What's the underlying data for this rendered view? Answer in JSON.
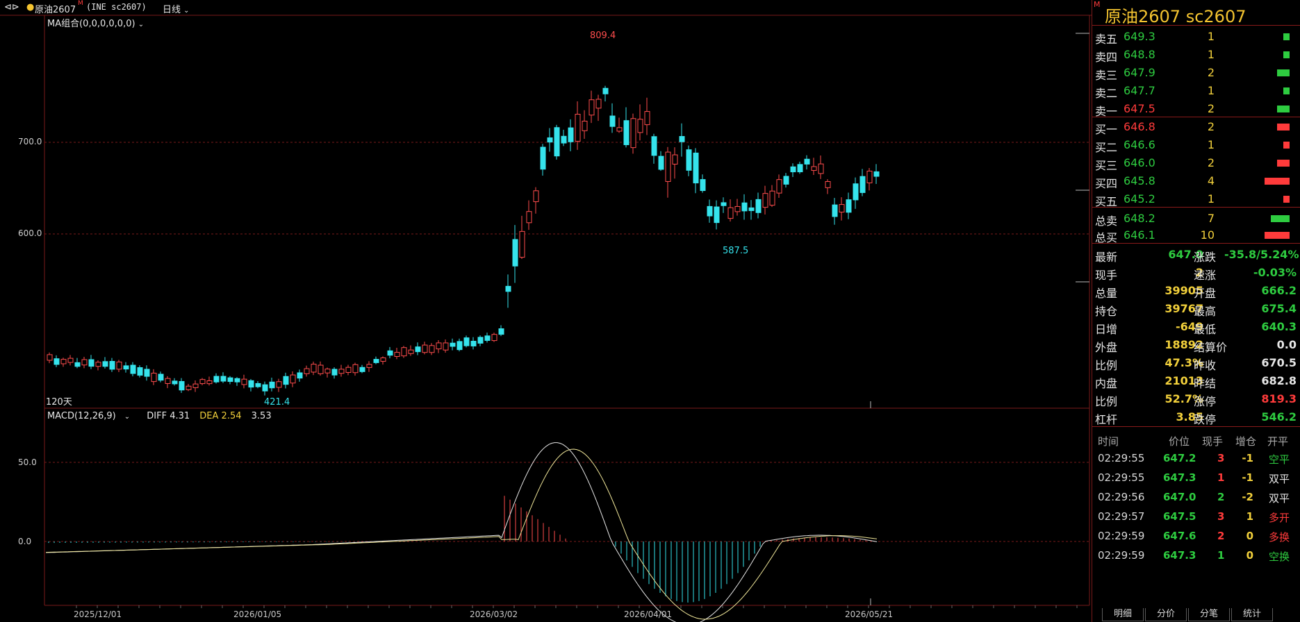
{
  "header": {
    "back_icon": "double-arrow-icon",
    "symbol_label": "原油2607",
    "symbol_marker": "M",
    "symbol_code": "(INE sc2607)",
    "period": "日线",
    "ma_legend": "MA组合(0,0,0,0,0,0)",
    "days_label": "120天"
  },
  "price_axis": {
    "levels": [
      "700.0",
      "600.0"
    ]
  },
  "macd_axis": {
    "levels": [
      "50.0",
      "0.0"
    ]
  },
  "macd_legend": {
    "name": "MACD(12,26,9)",
    "diff": "DIFF 4.31",
    "dea": "DEA 2.54",
    "macd": "3.53"
  },
  "annotations": {
    "high": "809.4",
    "low1": "421.4",
    "low2": "587.5"
  },
  "x_axis": {
    "dates": [
      "2025/12/01",
      "2026/01/05",
      "2026/03/02",
      "2026/04/01",
      "2026/05/21"
    ]
  },
  "colors": {
    "up": "#ff4d4d",
    "down": "#35e3ec",
    "accent": "#f4c430",
    "green": "#2ecc40",
    "red": "#ff3b3b",
    "grid": "#7a1a1a"
  },
  "panel": {
    "title": "原油2607  sc2607",
    "marker": "M",
    "asks": [
      {
        "label": "卖五",
        "price": "649.3",
        "vol": "1",
        "bar": 1
      },
      {
        "label": "卖四",
        "price": "648.8",
        "vol": "1",
        "bar": 1
      },
      {
        "label": "卖三",
        "price": "647.9",
        "vol": "2",
        "bar": 2
      },
      {
        "label": "卖二",
        "price": "647.7",
        "vol": "1",
        "bar": 1
      },
      {
        "label": "卖一",
        "price": "647.5",
        "vol": "2",
        "bar": 2
      }
    ],
    "bids": [
      {
        "label": "买一",
        "price": "646.8",
        "vol": "2",
        "bar": 2
      },
      {
        "label": "买二",
        "price": "646.6",
        "vol": "1",
        "bar": 1
      },
      {
        "label": "买三",
        "price": "646.0",
        "vol": "2",
        "bar": 2
      },
      {
        "label": "买四",
        "price": "645.8",
        "vol": "4",
        "bar": 4
      },
      {
        "label": "买五",
        "price": "645.2",
        "vol": "1",
        "bar": 1
      }
    ],
    "totals": [
      {
        "label": "总卖",
        "price": "648.2",
        "vol": "7",
        "bar": 3
      },
      {
        "label": "总买",
        "price": "646.1",
        "vol": "10",
        "bar": 4
      }
    ],
    "info": [
      {
        "l": "最新",
        "v": "647.0",
        "c1": "g",
        "l2": "涨跌",
        "v2": "-35.8/5.24%",
        "c2": "g"
      },
      {
        "l": "现手",
        "v": "2",
        "c1": "y",
        "l2": "速涨",
        "v2": "-0.03%",
        "c2": "g"
      },
      {
        "l": "总量",
        "v": "39905",
        "c1": "y",
        "l2": "开盘",
        "v2": "666.2",
        "c2": "g"
      },
      {
        "l": "持仓",
        "v": "39767",
        "c1": "y",
        "l2": "最高",
        "v2": "675.4",
        "c2": "g"
      },
      {
        "l": "日增",
        "v": "-649",
        "c1": "y",
        "l2": "最低",
        "v2": "640.3",
        "c2": "g"
      },
      {
        "l": "外盘",
        "v": "18892",
        "c1": "y",
        "l2": "结算价",
        "v2": "0.0",
        "c2": "w"
      },
      {
        "l": "比例",
        "v": "47.3%",
        "c1": "y",
        "l2": "昨收",
        "v2": "670.5",
        "c2": "w"
      },
      {
        "l": "内盘",
        "v": "21013",
        "c1": "y",
        "l2": "昨结",
        "v2": "682.8",
        "c2": "w"
      },
      {
        "l": "比例",
        "v": "52.7%",
        "c1": "y",
        "l2": "涨停",
        "v2": "819.3",
        "c2": "r"
      },
      {
        "l": "杠杆",
        "v": "3.85",
        "c1": "y",
        "l2": "跌停",
        "v2": "546.2",
        "c2": "g"
      }
    ],
    "tick_headers": [
      "时间",
      "价位",
      "现手",
      "增仓",
      "开平"
    ],
    "ticks": [
      {
        "time": "02:29:55",
        "price": "647.2",
        "vol": "3",
        "vc": "r",
        "chg": "-1",
        "type": "空平",
        "tc": "g"
      },
      {
        "time": "02:29:55",
        "price": "647.3",
        "vol": "1",
        "vc": "r",
        "chg": "-1",
        "type": "双平",
        "tc": "w"
      },
      {
        "time": "02:29:56",
        "price": "647.0",
        "vol": "2",
        "vc": "g",
        "chg": "-2",
        "type": "双平",
        "tc": "w"
      },
      {
        "time": "02:29:57",
        "price": "647.5",
        "vol": "3",
        "vc": "r",
        "chg": "1",
        "type": "多开",
        "tc": "r"
      },
      {
        "time": "02:29:59",
        "price": "647.6",
        "vol": "2",
        "vc": "r",
        "chg": "0",
        "type": "多换",
        "tc": "r"
      },
      {
        "time": "02:29:59",
        "price": "647.3",
        "vol": "1",
        "vc": "g",
        "chg": "0",
        "type": "空换",
        "tc": "g"
      }
    ],
    "tabs": [
      "明细",
      "分价",
      "分笔",
      "统计"
    ]
  }
}
